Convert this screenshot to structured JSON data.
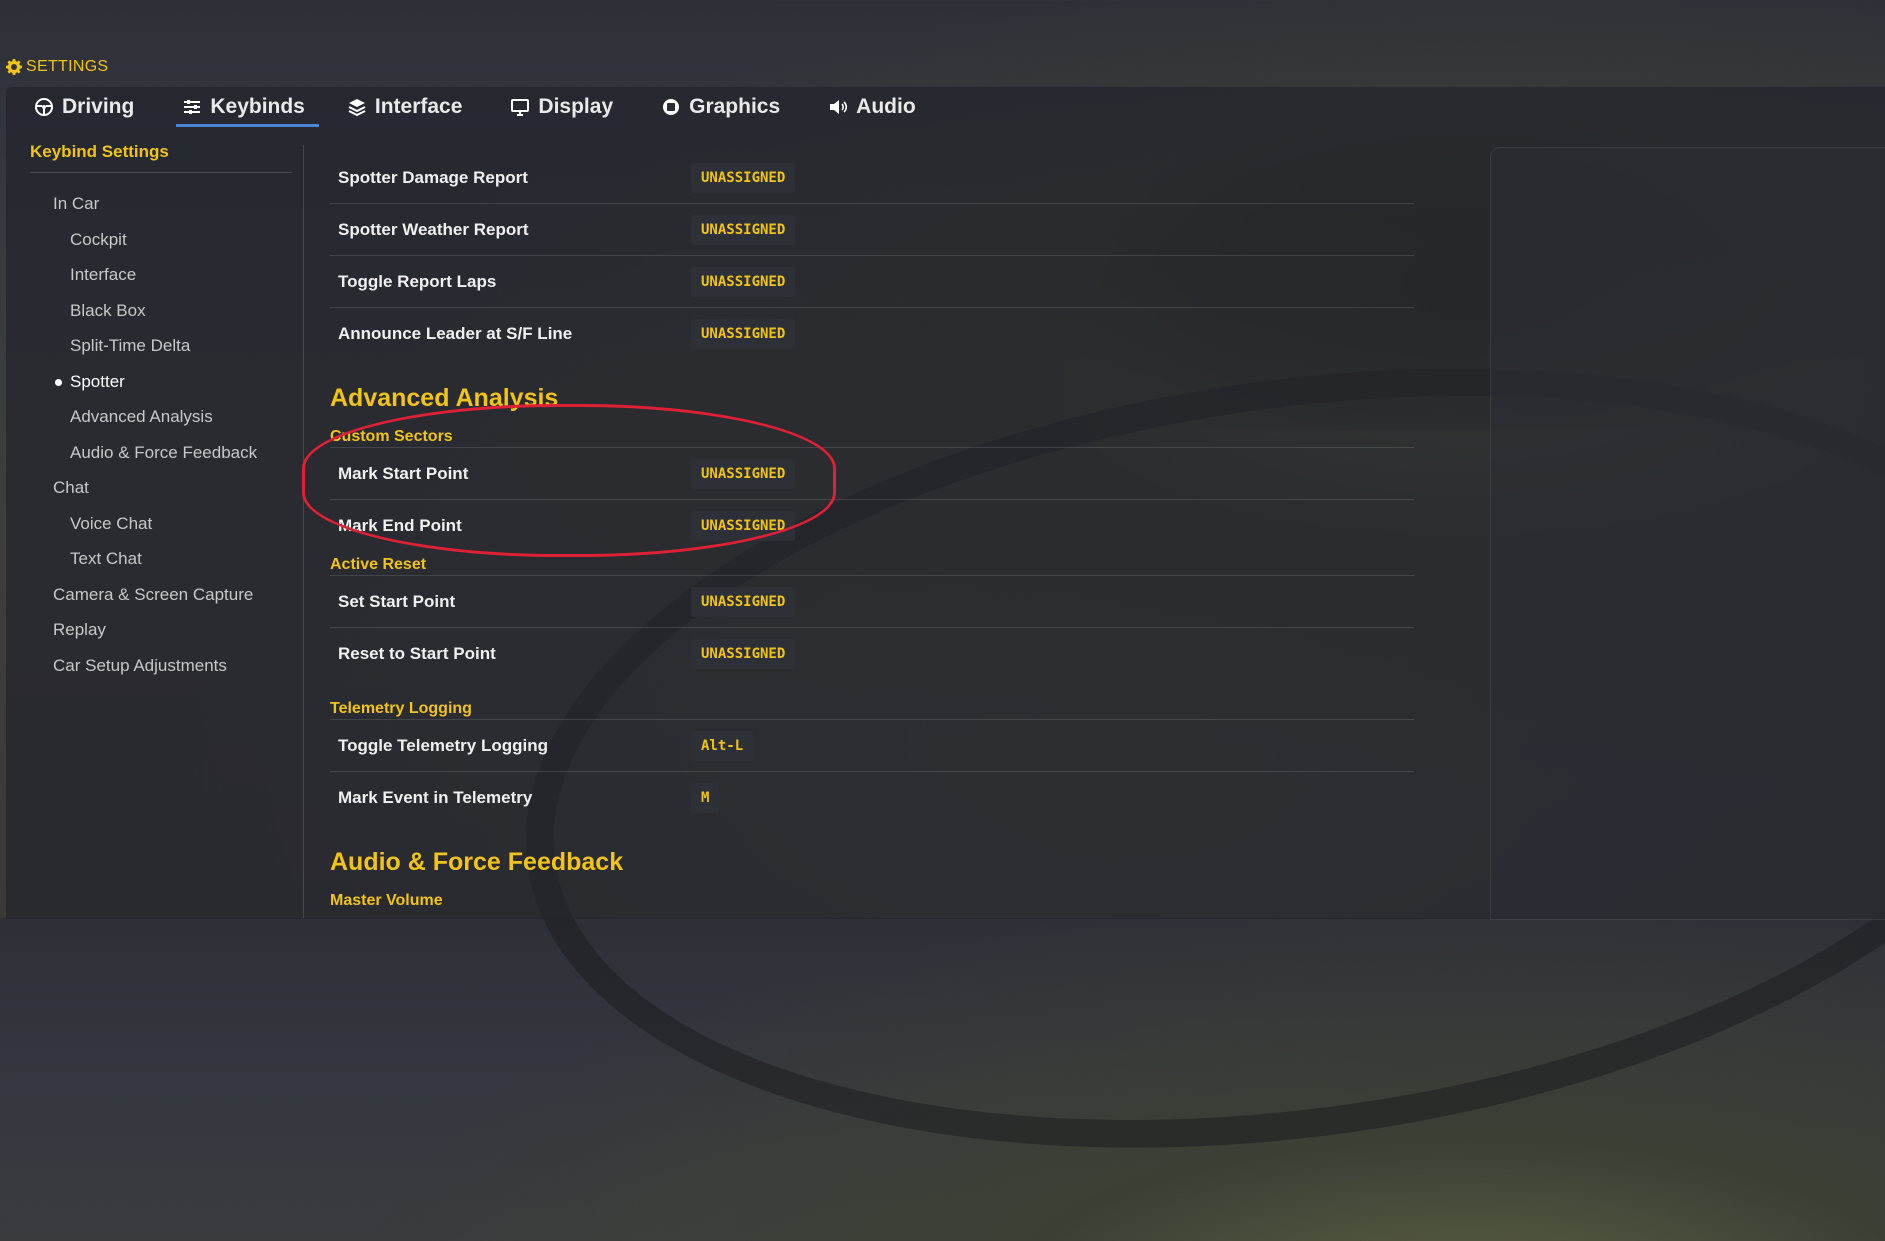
{
  "header": {
    "title": "SETTINGS",
    "icon": "gear-icon",
    "accent_color": "#f2c318"
  },
  "tabs": [
    {
      "label": "Driving",
      "icon": "steering-wheel-icon",
      "active": false
    },
    {
      "label": "Keybinds",
      "icon": "sliders-icon",
      "active": true
    },
    {
      "label": "Interface",
      "icon": "layers-icon",
      "active": false
    },
    {
      "label": "Display",
      "icon": "monitor-icon",
      "active": false
    },
    {
      "label": "Graphics",
      "icon": "gpu-chip-icon",
      "active": false
    },
    {
      "label": "Audio",
      "icon": "speaker-icon",
      "active": false
    }
  ],
  "sidebar": {
    "title": "Keybind Settings",
    "items": [
      {
        "label": "In Car",
        "level": 1
      },
      {
        "label": "Cockpit",
        "level": 2
      },
      {
        "label": "Interface",
        "level": 2
      },
      {
        "label": "Black Box",
        "level": 2
      },
      {
        "label": "Split-Time Delta",
        "level": 2
      },
      {
        "label": "Spotter",
        "level": 2,
        "active": true
      },
      {
        "label": "Advanced Analysis",
        "level": 2
      },
      {
        "label": "Audio & Force Feedback",
        "level": 2
      },
      {
        "label": "Chat",
        "level": 1
      },
      {
        "label": "Voice Chat",
        "level": 2
      },
      {
        "label": "Text Chat",
        "level": 2
      },
      {
        "label": "Camera & Screen Capture",
        "level": 1
      },
      {
        "label": "Replay",
        "level": 1
      },
      {
        "label": "Car Setup Adjustments",
        "level": 1
      }
    ]
  },
  "content": {
    "spotter_rows": [
      {
        "label": "Spotter Damage Report",
        "key": "UNASSIGNED"
      },
      {
        "label": "Spotter Weather Report",
        "key": "UNASSIGNED"
      },
      {
        "label": "Toggle Report Laps",
        "key": "UNASSIGNED"
      },
      {
        "label": "Announce Leader at S/F Line",
        "key": "UNASSIGNED"
      }
    ],
    "advanced_analysis": {
      "heading": "Advanced Analysis",
      "custom_sectors": {
        "title": "Custom Sectors",
        "rows": [
          {
            "label": "Mark Start Point",
            "key": "UNASSIGNED"
          },
          {
            "label": "Mark End Point",
            "key": "UNASSIGNED"
          }
        ]
      },
      "active_reset": {
        "title": "Active Reset",
        "rows": [
          {
            "label": "Set Start Point",
            "key": "UNASSIGNED"
          },
          {
            "label": "Reset to Start Point",
            "key": "UNASSIGNED"
          }
        ]
      },
      "telemetry_logging": {
        "title": "Telemetry Logging",
        "rows": [
          {
            "label": "Toggle Telemetry Logging",
            "key": "Alt-L"
          },
          {
            "label": "Mark Event in Telemetry",
            "key": "M"
          }
        ]
      }
    },
    "audio_ffb": {
      "heading": "Audio & Force Feedback",
      "master_volume_title": "Master Volume"
    }
  },
  "colors": {
    "accent": "#f2c318",
    "tab_underline": "#4a86d8",
    "highlight": "#e02035"
  }
}
